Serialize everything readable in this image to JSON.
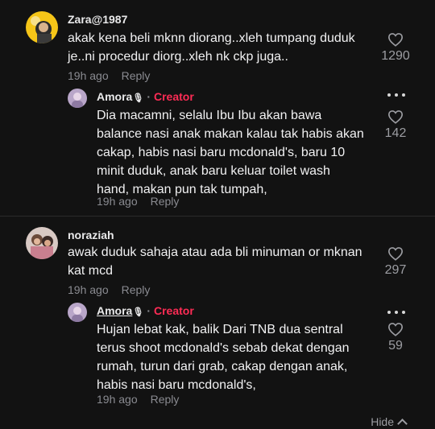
{
  "comments": [
    {
      "username": "Zara@1987",
      "text": "akak kena beli mknn diorang..xleh tumpang duduk\nje..ni procedur diorg..xleh nk ckp juga..",
      "time": "19h ago",
      "reply_label": "Reply",
      "likes": "1290",
      "reply": {
        "username": "Amora",
        "badge": "Creator",
        "text": "Dia macamni, selalu Ibu Ibu akan bawa\nbalance nasi anak makan kalau tak habis akan\ncakap, habis nasi baru mcdonald's, baru 10\nminit duduk, anak baru keluar toilet wash\nhand, makan pun tak tumpah,",
        "time": "19h ago",
        "reply_label": "Reply",
        "likes": "142"
      }
    },
    {
      "username": "noraziah",
      "text": "awak duduk sahaja atau ada bli minuman or mknan\nkat mcd",
      "time": "19h ago",
      "reply_label": "Reply",
      "likes": "297",
      "reply": {
        "username": "Amora",
        "badge": "Creator",
        "text": "Hujan lebat kak, balik Dari TNB dua sentral\nterus shoot mcdonald's sebab dekat dengan\nrumah, turun dari grab, cakap dengan anak,\nhabis nasi baru mcdonald's,",
        "time": "19h ago",
        "reply_label": "Reply",
        "likes": "59"
      }
    }
  ],
  "footer": {
    "hide_label": "Hide"
  },
  "colors": {
    "background": "#121212",
    "creator": "#fe2c55",
    "muted": "#8a8b91"
  }
}
